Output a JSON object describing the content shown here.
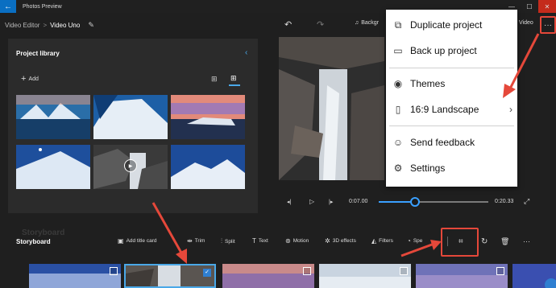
{
  "app": {
    "title": "Photos Preview",
    "back_glyph": "←",
    "window_controls": [
      "—",
      "☐",
      "✕"
    ]
  },
  "breadcrumb": {
    "root": "Video Editor",
    "separator": ">",
    "current": "Video Uno"
  },
  "toolbar": {
    "music_label": "Backgr",
    "video_label": "Video",
    "more_glyph": "···"
  },
  "library": {
    "title": "Project library",
    "add_label": "Add",
    "collapse_glyph": "‹",
    "view_large_glyph": "⊞",
    "view_small_glyph": "⊞"
  },
  "player": {
    "current_time": "0:07.00",
    "total_time": "0:20.33",
    "progress": 0.33
  },
  "menu": {
    "items": [
      {
        "label": "Duplicate project",
        "icon": "duplicate-icon",
        "glyph": "⧉"
      },
      {
        "label": "Back up project",
        "icon": "backup-icon",
        "glyph": "▭"
      },
      {
        "label": "Themes",
        "icon": "palette-icon",
        "glyph": "◉"
      },
      {
        "label": "16:9 Landscape",
        "icon": "aspect-ratio-icon",
        "glyph": "▯",
        "arrow": "›"
      },
      {
        "label": "Send feedback",
        "icon": "feedback-icon",
        "glyph": "☺"
      },
      {
        "label": "Settings",
        "icon": "gear-icon",
        "glyph": "⚙"
      }
    ]
  },
  "storyboard": {
    "ghost_title": "Storyboard",
    "title": "Storyboard",
    "tools": [
      {
        "label": "Add title card",
        "glyph": "▣"
      },
      {
        "label": "Trim",
        "glyph": "⇹"
      },
      {
        "label": "Split",
        "glyph": "⫶"
      },
      {
        "label": "Text",
        "glyph": "T"
      },
      {
        "label": "Motion",
        "glyph": "⊛"
      },
      {
        "label": "3D effects",
        "glyph": "✲"
      },
      {
        "label": "Filters",
        "glyph": "◭"
      },
      {
        "label": "Spe",
        "glyph": "◔"
      }
    ],
    "icon_tools": [
      {
        "name": "crop-bars-icon",
        "glyph": "⌗"
      },
      {
        "name": "rotate-icon",
        "glyph": "↻"
      },
      {
        "name": "delete-icon",
        "glyph": "🗑"
      },
      {
        "name": "more-icon",
        "glyph": "···"
      }
    ]
  },
  "colors": {
    "accent": "#3aa0ff",
    "highlight_red": "#e5483a",
    "menu_bg": "#ffffff",
    "panel_bg": "#2b2b2b"
  }
}
